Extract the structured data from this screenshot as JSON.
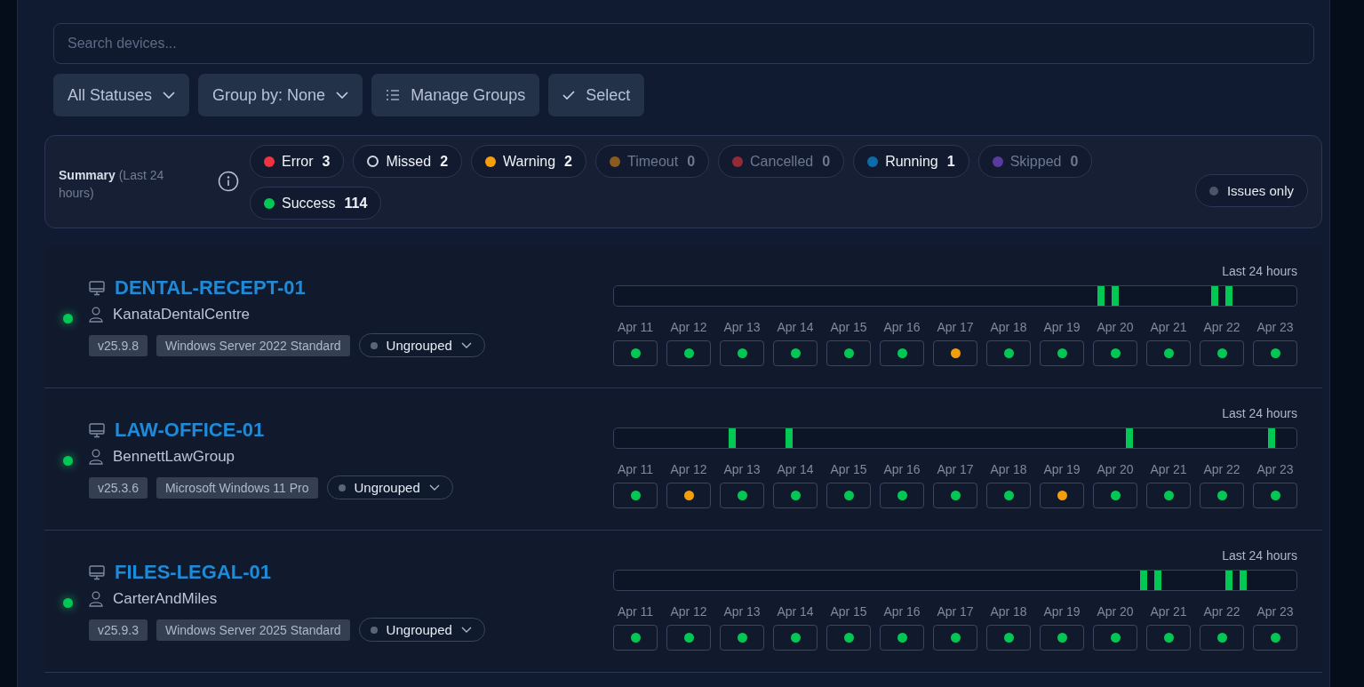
{
  "search": {
    "placeholder": "Search devices..."
  },
  "filters": [
    {
      "kind": "dropdown",
      "label": "All Statuses"
    },
    {
      "kind": "dropdown",
      "label": "Group by:  None"
    },
    {
      "kind": "manage",
      "label": "Manage Groups"
    },
    {
      "kind": "select",
      "label": "Select"
    }
  ],
  "summary": {
    "title": "Summary",
    "subtitle": "(Last 24 hours)",
    "chips": [
      {
        "kind": "dot",
        "label": "Error",
        "count": "3",
        "color": "#ef3340",
        "muted": false
      },
      {
        "kind": "ring",
        "label": "Missed",
        "count": "2",
        "color": "#d0d6e0",
        "muted": false
      },
      {
        "kind": "dot",
        "label": "Warning",
        "count": "2",
        "color": "#f59e0b",
        "muted": false
      },
      {
        "kind": "dot",
        "label": "Timeout",
        "count": "0",
        "color": "#8a5a1e",
        "muted": true
      },
      {
        "kind": "dot",
        "label": "Cancelled",
        "count": "0",
        "color": "#932a35",
        "muted": true
      },
      {
        "kind": "dot",
        "label": "Running",
        "count": "1",
        "color": "#0e6aa8",
        "muted": false
      },
      {
        "kind": "dot",
        "label": "Skipped",
        "count": "0",
        "color": "#5b3aa0",
        "muted": true
      },
      {
        "kind": "dot",
        "label": "Success",
        "count": "114",
        "color": "#00c853",
        "muted": false
      }
    ],
    "issues_only": {
      "label": "Issues only",
      "on": false
    }
  },
  "devices": [
    {
      "name": "DENTAL-RECEPT-01",
      "online": true,
      "customer": "KanataDentalCentre",
      "version": "v25.9.8",
      "os": "Windows Server 2022 Standard",
      "group": "Ungrouped",
      "range_label": "Last 24 hours",
      "marks": [
        {
          "level": 0.714
        },
        {
          "level": 0.735
        },
        {
          "level": 0.88
        },
        {
          "level": 0.901
        }
      ],
      "days": [
        {
          "date": "Apr 11",
          "color": "#00c853"
        },
        {
          "date": "Apr 12",
          "color": "#00c853"
        },
        {
          "date": "Apr 13",
          "color": "#00c853"
        },
        {
          "date": "Apr 14",
          "color": "#00c853"
        },
        {
          "date": "Apr 15",
          "color": "#00c853"
        },
        {
          "date": "Apr 16",
          "color": "#00c853"
        },
        {
          "date": "Apr 17",
          "color": "#f59e0b"
        },
        {
          "date": "Apr 18",
          "color": "#00c853"
        },
        {
          "date": "Apr 19",
          "color": "#00c853"
        },
        {
          "date": "Apr 20",
          "color": "#00c853"
        },
        {
          "date": "Apr 21",
          "color": "#00c853"
        },
        {
          "date": "Apr 22",
          "color": "#00c853"
        },
        {
          "date": "Apr 23",
          "color": "#00c853"
        }
      ]
    },
    {
      "name": "LAW-OFFICE-01",
      "online": true,
      "customer": "BennettLawGroup",
      "version": "v25.3.6",
      "os": "Microsoft Windows 11 Pro",
      "group": "Ungrouped",
      "range_label": "Last 24 hours",
      "marks": [
        {
          "level": 0.173
        },
        {
          "level": 0.256
        },
        {
          "level": 0.755
        },
        {
          "level": 0.964
        }
      ],
      "days": [
        {
          "date": "Apr 11",
          "color": "#00c853"
        },
        {
          "date": "Apr 12",
          "color": "#f59e0b"
        },
        {
          "date": "Apr 13",
          "color": "#00c853"
        },
        {
          "date": "Apr 14",
          "color": "#00c853"
        },
        {
          "date": "Apr 15",
          "color": "#00c853"
        },
        {
          "date": "Apr 16",
          "color": "#00c853"
        },
        {
          "date": "Apr 17",
          "color": "#00c853"
        },
        {
          "date": "Apr 18",
          "color": "#00c853"
        },
        {
          "date": "Apr 19",
          "color": "#f59e0b"
        },
        {
          "date": "Apr 20",
          "color": "#00c853"
        },
        {
          "date": "Apr 21",
          "color": "#00c853"
        },
        {
          "date": "Apr 22",
          "color": "#00c853"
        },
        {
          "date": "Apr 23",
          "color": "#00c853"
        }
      ]
    },
    {
      "name": "FILES-LEGAL-01",
      "online": true,
      "customer": "CarterAndMiles",
      "version": "v25.9.3",
      "os": "Windows Server 2025 Standard",
      "group": "Ungrouped",
      "range_label": "Last 24 hours",
      "marks": [
        {
          "level": 0.776
        },
        {
          "level": 0.797
        },
        {
          "level": 0.901
        },
        {
          "level": 0.922
        }
      ],
      "days": [
        {
          "date": "Apr 11",
          "color": "#00c853"
        },
        {
          "date": "Apr 12",
          "color": "#00c853"
        },
        {
          "date": "Apr 13",
          "color": "#00c853"
        },
        {
          "date": "Apr 14",
          "color": "#00c853"
        },
        {
          "date": "Apr 15",
          "color": "#00c853"
        },
        {
          "date": "Apr 16",
          "color": "#00c853"
        },
        {
          "date": "Apr 17",
          "color": "#00c853"
        },
        {
          "date": "Apr 18",
          "color": "#00c853"
        },
        {
          "date": "Apr 19",
          "color": "#00c853"
        },
        {
          "date": "Apr 20",
          "color": "#00c853"
        },
        {
          "date": "Apr 21",
          "color": "#00c853"
        },
        {
          "date": "Apr 22",
          "color": "#00c853"
        },
        {
          "date": "Apr 23",
          "color": "#00c853"
        }
      ]
    }
  ]
}
